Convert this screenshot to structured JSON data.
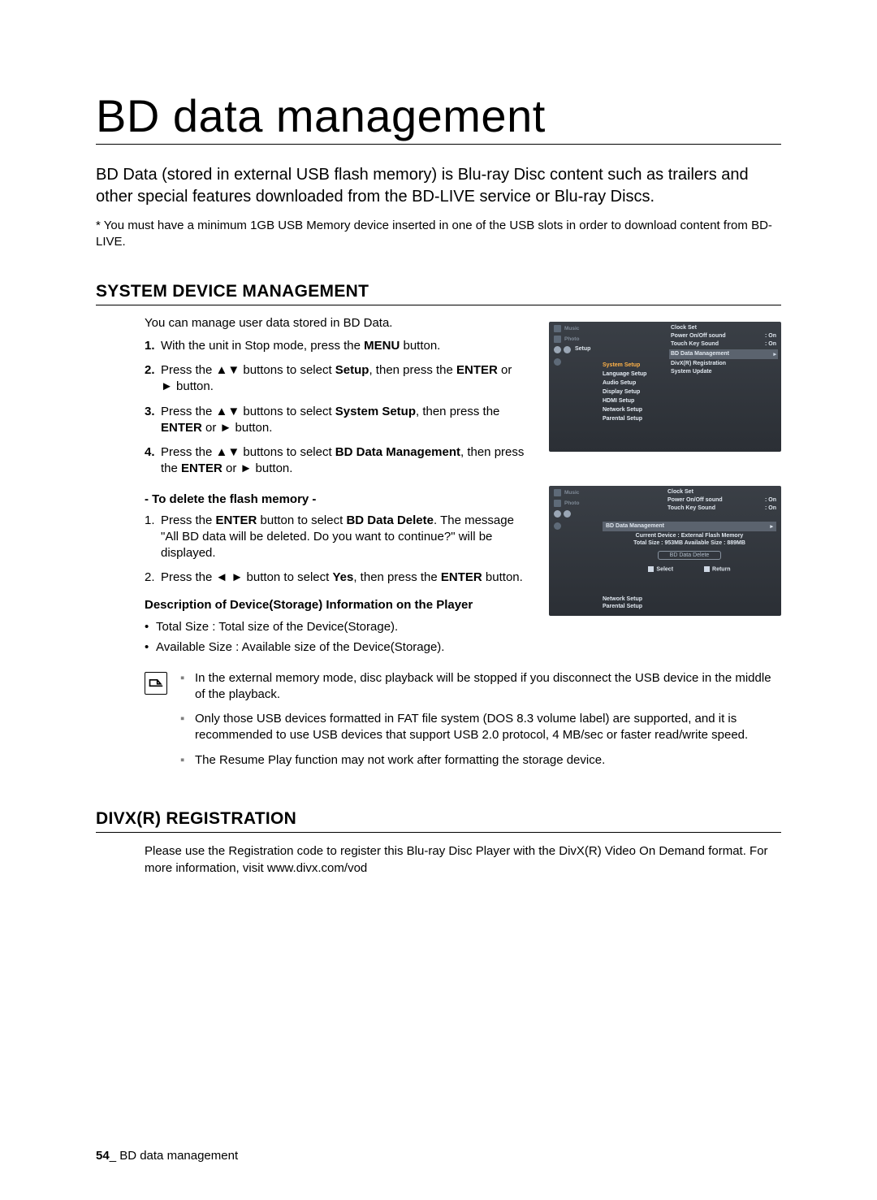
{
  "title": "BD data management",
  "intro": "BD Data (stored in external USB flash memory) is Blu-ray Disc content such as trailers and other special features downloaded from the BD-LIVE service or Blu-ray Discs.",
  "footnote": "* You must have a minimum 1GB USB Memory device inserted in one of the USB slots in order to download content from BD-LIVE.",
  "section1": {
    "heading": "SYSTEM DEVICE MANAGEMENT",
    "lead": "You can manage user data stored in BD Data.",
    "steps": [
      {
        "n": "1.",
        "pre": "With the unit in Stop mode, press the ",
        "b": "MENU",
        "post": " button."
      },
      {
        "n": "2.",
        "pre": "Press the ▲▼ buttons to select ",
        "b": "Setup",
        "post": ", then press the ",
        "b2": "ENTER",
        "post2": " or ► button."
      },
      {
        "n": "3.",
        "pre": "Press the ▲▼ buttons to select ",
        "b": "System Setup",
        "post": ", then press the ",
        "b2": "ENTER",
        "post2": " or ► button."
      },
      {
        "n": "4.",
        "pre": "Press the ▲▼ buttons to select ",
        "b": "BD Data Management",
        "post": ", then press the  ",
        "b2": "ENTER",
        "post2": " or ► button."
      }
    ],
    "delHead": "- To delete the flash memory -",
    "delSteps": [
      {
        "n": "1.",
        "t1": "Press the ",
        "b": "ENTER",
        "t2": " button to select ",
        "b2": "BD Data Delete",
        "t3": ". The message \"All BD data will be deleted. Do you want to continue?\" will be displayed."
      },
      {
        "n": "2.",
        "t1": "Press the ◄ ► button to select ",
        "b": "Yes",
        "t2": ", then press the ",
        "b2": "ENTER",
        "t3": " button."
      }
    ],
    "descHead": "Description of Device(Storage) Information on the Player",
    "descBullets": [
      "Total Size : Total size of the Device(Storage).",
      "Available Size : Available size of the Device(Storage)."
    ],
    "notes": [
      "In the external memory mode, disc playback will be stopped if you disconnect the USB device in the middle of the playback.",
      "Only those USB devices formatted in FAT file system (DOS 8.3 volume label) are supported, and it is recommended to use USB devices that support USB 2.0 protocol, 4 MB/sec or faster read/write speed.",
      "The Resume Play function may not work after formatting the storage device."
    ]
  },
  "section2": {
    "heading": "DIVX(R) REGISTRATION",
    "body": "Please use the Registration code to register this Blu-ray Disc Player with the DivX(R) Video On Demand format. For more information, visit www.divx.com/vod"
  },
  "ss1": {
    "sb": {
      "music": "Music",
      "photo": "Photo",
      "setup": "Setup"
    },
    "menu": {
      "hi": "System Setup",
      "items": [
        "Language Setup",
        "Audio Setup",
        "Display Setup",
        "HDMI Setup",
        "Network Setup",
        "Parental Setup"
      ]
    },
    "right": {
      "k1": "Clock Set",
      "k2": "Power On/Off sound",
      "v2": ": On",
      "k3": "Touch Key Sound",
      "v3": ": On",
      "hl": "BD Data Management",
      "arrow": "▸",
      "k4": "DivX(R) Registration",
      "k5": "System Update"
    }
  },
  "ss2": {
    "top": {
      "k1": "Clock Set",
      "k2": "Power On/Off sound",
      "v2": ": On",
      "k3": "Touch Key Sound",
      "v3": ": On"
    },
    "bar": "BD Data Management",
    "arrow": "▸",
    "c1": "Current Device : External Flash Memory",
    "c2": "Total Size : 953MB    Available Size : 889MB",
    "pill": "BD Data Delete",
    "select": "Select",
    "return": "Return",
    "foot": [
      "Network Setup",
      "Parental Setup"
    ]
  },
  "footer": {
    "page": "54",
    "sep": "_ ",
    "label": "BD data management"
  }
}
